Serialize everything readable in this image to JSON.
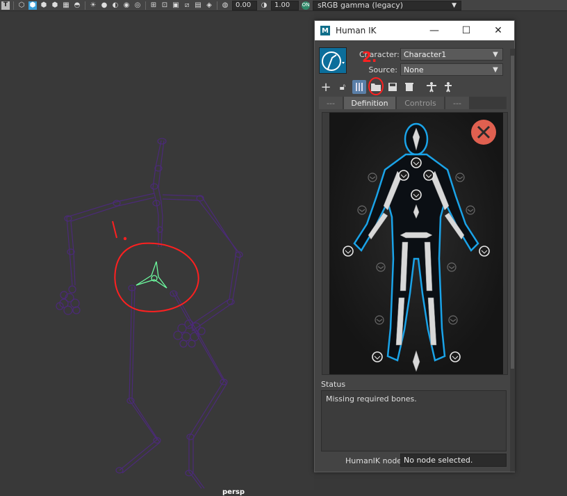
{
  "toolbar": {
    "exposure_value": "0.00",
    "gamma_value": "1.00",
    "color_space": "sRGB gamma (legacy)",
    "icons": [
      "text-icon",
      "cube-wire-icon",
      "cube-shaded-icon",
      "cube-textured-icon",
      "cube-lit-icon",
      "checker-icon",
      "texture-icon",
      "light-icon",
      "shadow-icon",
      "ao-icon",
      "motion-blur-icon",
      "aa-icon",
      "film-gate-icon",
      "resolution-gate-icon",
      "safe-action-icon",
      "isolate-icon",
      "grid-icon",
      "xray-icon",
      "exposure-icon",
      "gamma-icon",
      "color-mgmt-icon"
    ]
  },
  "viewport": {
    "camera_label": "persp"
  },
  "annotations": {
    "step1": "1.",
    "step2": "2."
  },
  "window": {
    "title": "Human IK",
    "logo_letter": "M",
    "minimize": "—",
    "maximize": "☐",
    "close": "✕"
  },
  "character": {
    "label": "Character:",
    "value": "Character1",
    "source_label": "Source:",
    "source_value": "None"
  },
  "tools": [
    "create-icon",
    "lock-icon",
    "skeleton-icon",
    "open-folder-icon",
    "save-icon",
    "delete-icon",
    "t-pose-icon",
    "stance-icon"
  ],
  "tabs": [
    {
      "label": "---",
      "active": false
    },
    {
      "label": "Definition",
      "active": true
    },
    {
      "label": "Controls",
      "active": false
    },
    {
      "label": "---",
      "active": false
    }
  ],
  "status": {
    "label": "Status",
    "message": "Missing required bones."
  },
  "node": {
    "label": "HumanIK node",
    "value": "No node selected."
  },
  "colors": {
    "accent_blue": "#1aa3e8",
    "annotation_red": "#ff2020",
    "joint_purple": "#5a2d82",
    "selected_green": "#6dfca0",
    "error_red": "#e06050"
  }
}
